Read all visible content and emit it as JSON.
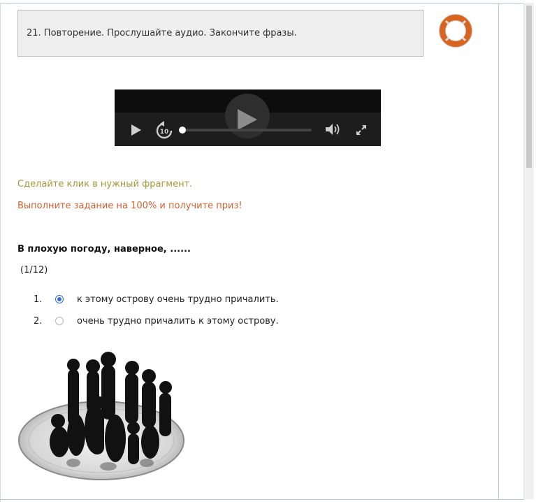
{
  "task": {
    "title": "21. Повторение. Прослушайте аудио. Закончите фразы."
  },
  "icons": {
    "help": "lifebuoy-icon",
    "play": "play-icon",
    "rewind": "rewind-10-icon",
    "volume": "volume-icon",
    "fullscreen": "fullscreen-icon"
  },
  "player": {
    "progress": 0
  },
  "instructions": {
    "hint": "Сделайте клик в нужный фрагмент.",
    "prize": "Выполните задание на 100% и получите приз!"
  },
  "question": {
    "text": "В плохую погоду, наверное, ......",
    "counter": "(1/12)",
    "options": [
      {
        "number": "1.",
        "text": "к этому острову очень трудно причалить.",
        "selected": true
      },
      {
        "number": "2.",
        "text": "очень трудно причалить к этому острову.",
        "selected": false
      }
    ]
  },
  "colors": {
    "hint": "#a59a3a",
    "prize": "#d2602f",
    "radio_selected": "#2d6fd6",
    "lifebuoy": "#d9641e"
  }
}
